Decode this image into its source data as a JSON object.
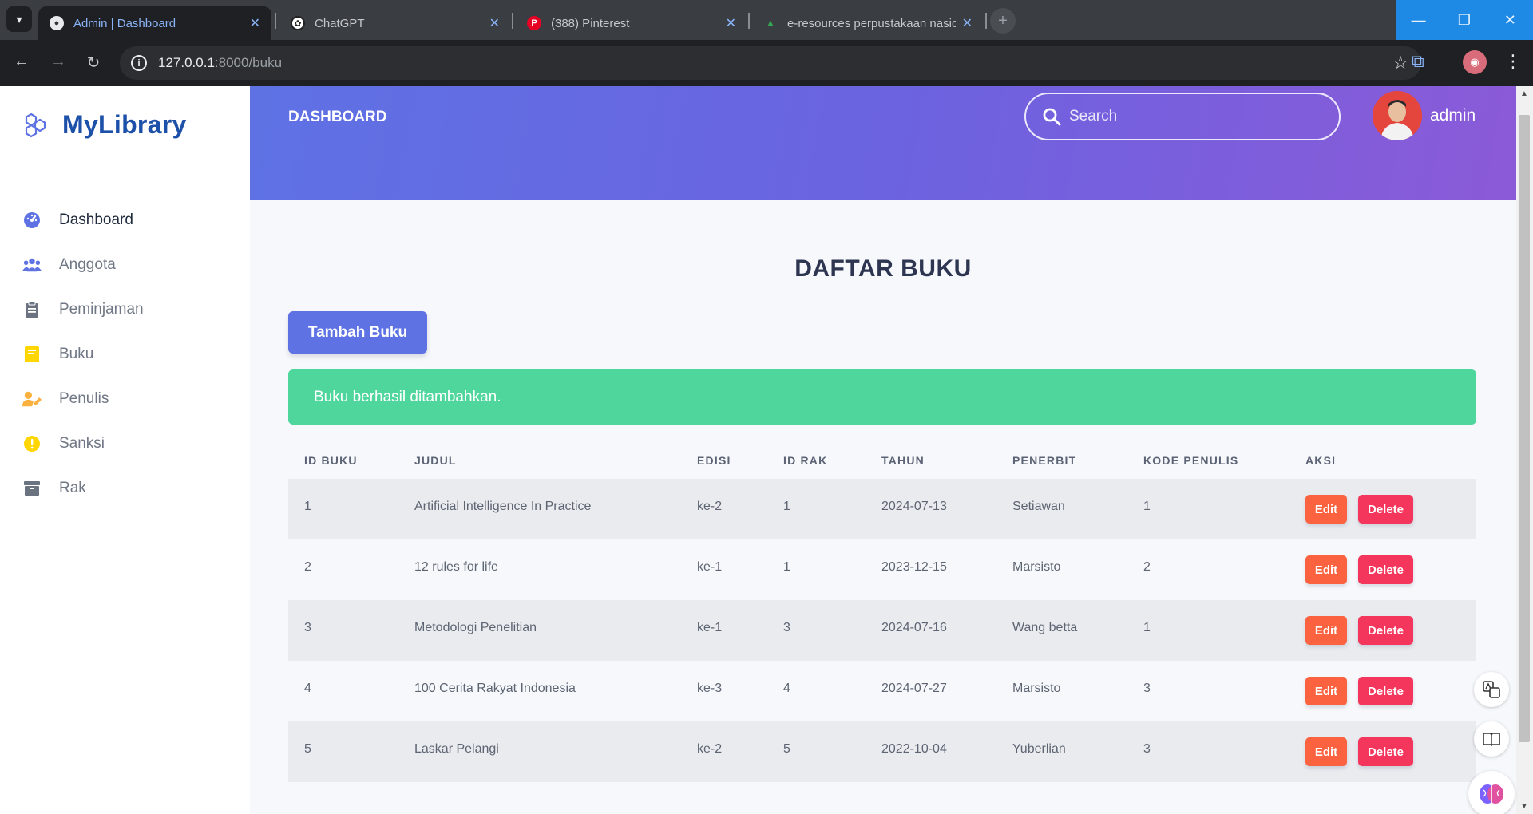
{
  "browser": {
    "tabs": [
      {
        "title": "Admin | Dashboard",
        "active": true
      },
      {
        "title": "ChatGPT",
        "active": false
      },
      {
        "title": "(388) Pinterest",
        "active": false
      },
      {
        "title": "e-resources perpustakaan nasio",
        "active": false
      }
    ],
    "url_host": "127.0.0.1",
    "url_path": ":8000/buku",
    "close_glyph": "✕",
    "new_tab_glyph": "+"
  },
  "sidebar": {
    "brand": "MyLibrary",
    "items": [
      {
        "label": "Dashboard",
        "icon": "dashboard-icon",
        "color": "#5e72e4"
      },
      {
        "label": "Anggota",
        "icon": "users-icon",
        "color": "#5e72e4"
      },
      {
        "label": "Peminjaman",
        "icon": "clipboard-icon",
        "color": "#6b7280"
      },
      {
        "label": "Buku",
        "icon": "book-icon",
        "color": "#ffd600"
      },
      {
        "label": "Penulis",
        "icon": "user-edit-icon",
        "color": "#fbb140"
      },
      {
        "label": "Sanksi",
        "icon": "warning-icon",
        "color": "#ffd600"
      },
      {
        "label": "Rak",
        "icon": "archive-icon",
        "color": "#6b7280"
      }
    ]
  },
  "header": {
    "title": "DASHBOARD",
    "search_placeholder": "Search",
    "username": "admin"
  },
  "main": {
    "title": "DAFTAR BUKU",
    "add_button": "Tambah Buku",
    "alert": "Buku berhasil ditambahkan.",
    "columns": [
      "ID BUKU",
      "JUDUL",
      "EDISI",
      "ID RAK",
      "TAHUN",
      "PENERBIT",
      "KODE PENULIS",
      "AKSI"
    ],
    "rows": [
      [
        "1",
        "Artificial Intelligence In Practice",
        "ke-2",
        "1",
        "2024-07-13",
        "Setiawan",
        "1"
      ],
      [
        "2",
        "12 rules for life",
        "ke-1",
        "1",
        "2023-12-15",
        "Marsisto",
        "2"
      ],
      [
        "3",
        "Metodologi Penelitian",
        "ke-1",
        "3",
        "2024-07-16",
        "Wang betta",
        "1"
      ],
      [
        "4",
        "100 Cerita Rakyat Indonesia",
        "ke-3",
        "4",
        "2024-07-27",
        "Marsisto",
        "3"
      ],
      [
        "5",
        "Laskar Pelangi",
        "ke-2",
        "5",
        "2022-10-04",
        "Yuberlian",
        "3"
      ]
    ],
    "edit_label": "Edit",
    "delete_label": "Delete"
  },
  "colors": {
    "primary": "#5e72e4",
    "success": "#4fd69c",
    "warning": "#fb6340",
    "danger": "#f5365c"
  }
}
